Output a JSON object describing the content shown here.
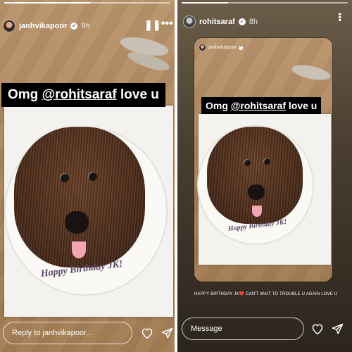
{
  "left_story": {
    "username": "janhvikapoor",
    "time": "9h",
    "caption": "Omg ",
    "mention": "@rohitsaraf",
    "caption_rest": " love u",
    "cake_text": "Happy Birthday JK!",
    "reply_placeholder": "Reply to janhvikapoor...",
    "pause_icon": "pause-icon",
    "more_icon": "more-icon"
  },
  "right_story": {
    "username": "rohitsaraf",
    "time": "8h",
    "embedded_username": "janhvikapoor",
    "caption": "Omg ",
    "mention": "@rohitsaraf",
    "caption_rest": " love u",
    "cake_text": "Happy Birthday JK!",
    "story_text": "HAPPY BIRTHDAY JK❤️ CAN'T WAIT TO TROUBLE U AGAIN LOVE U",
    "reply_placeholder": "Message",
    "more_icon": "more-icon"
  },
  "icons": {
    "like": "heart-icon",
    "share": "send-icon",
    "verified": "verified-badge-icon"
  },
  "colors": {
    "white": "#ffffff",
    "caption_bg": "#000000",
    "tongue": "#f2a5b4",
    "cake": "#4f2e1b"
  }
}
